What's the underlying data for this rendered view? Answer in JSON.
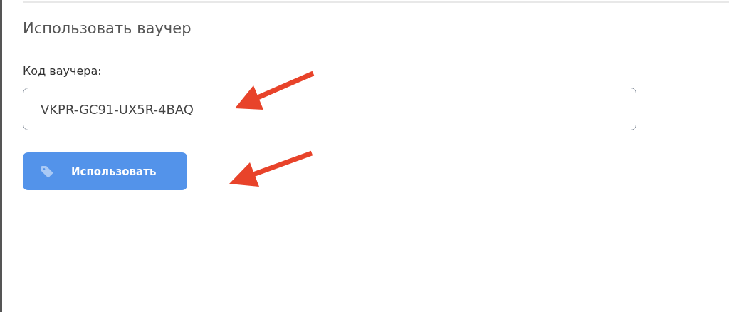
{
  "section": {
    "title": "Использовать ваучер"
  },
  "voucher_field": {
    "label": "Код ваучера:",
    "value": "VKPR-GC91-UX5R-4BAQ"
  },
  "apply_button": {
    "label": "Использовать"
  }
}
